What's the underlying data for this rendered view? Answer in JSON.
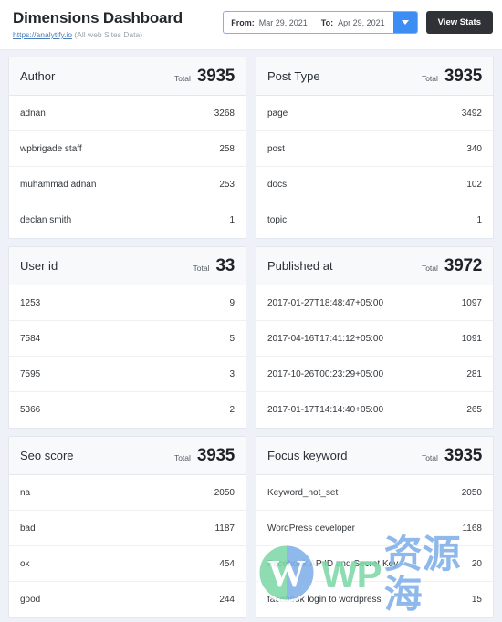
{
  "header": {
    "title": "Dimensions Dashboard",
    "site_link": "https://analytify.io",
    "site_scope": "(All web Sites Data)",
    "date_from_label": "From:",
    "date_from_value": "Mar 29, 2021",
    "date_to_label": "To:",
    "date_to_value": "Apr 29, 2021",
    "dropdown_icon": "chevron-down-icon",
    "view_stats_label": "View Stats"
  },
  "common": {
    "total_label": "Total"
  },
  "cards": [
    {
      "title": "Author",
      "total": "3935",
      "rows": [
        {
          "label": "adnan",
          "value": "3268"
        },
        {
          "label": "wpbrigade staff",
          "value": "258"
        },
        {
          "label": "muhammad adnan",
          "value": "253"
        },
        {
          "label": "declan smith",
          "value": "1"
        }
      ]
    },
    {
      "title": "Post Type",
      "total": "3935",
      "rows": [
        {
          "label": "page",
          "value": "3492"
        },
        {
          "label": "post",
          "value": "340"
        },
        {
          "label": "docs",
          "value": "102"
        },
        {
          "label": "topic",
          "value": "1"
        }
      ]
    },
    {
      "title": "User id",
      "total": "33",
      "rows": [
        {
          "label": "1253",
          "value": "9"
        },
        {
          "label": "7584",
          "value": "5"
        },
        {
          "label": "7595",
          "value": "3"
        },
        {
          "label": "5366",
          "value": "2"
        }
      ]
    },
    {
      "title": "Published at",
      "total": "3972",
      "rows": [
        {
          "label": "2017-01-27T18:48:47+05:00",
          "value": "1097"
        },
        {
          "label": "2017-04-16T17:41:12+05:00",
          "value": "1091"
        },
        {
          "label": "2017-10-26T00:23:29+05:00",
          "value": "281"
        },
        {
          "label": "2017-01-17T14:14:40+05:00",
          "value": "265"
        }
      ]
    },
    {
      "title": "Seo score",
      "total": "3935",
      "rows": [
        {
          "label": "na",
          "value": "2050"
        },
        {
          "label": "bad",
          "value": "1187"
        },
        {
          "label": "ok",
          "value": "454"
        },
        {
          "label": "good",
          "value": "244"
        }
      ]
    },
    {
      "title": "Focus keyword",
      "total": "3935",
      "rows": [
        {
          "label": "Keyword_not_set",
          "value": "2050"
        },
        {
          "label": "WordPress developer",
          "value": "1168"
        },
        {
          "label": "Facebook AP ID and Secret Key",
          "value": "20"
        },
        {
          "label": "facebook login to wordpress",
          "value": "15"
        }
      ]
    }
  ],
  "watermark": {
    "logo_icon": "wordpress-logo-icon",
    "text_latin": "WP",
    "text_cjk": "资源海",
    "color_green": "#7ed8a8",
    "color_blue": "#7fb0e8"
  }
}
